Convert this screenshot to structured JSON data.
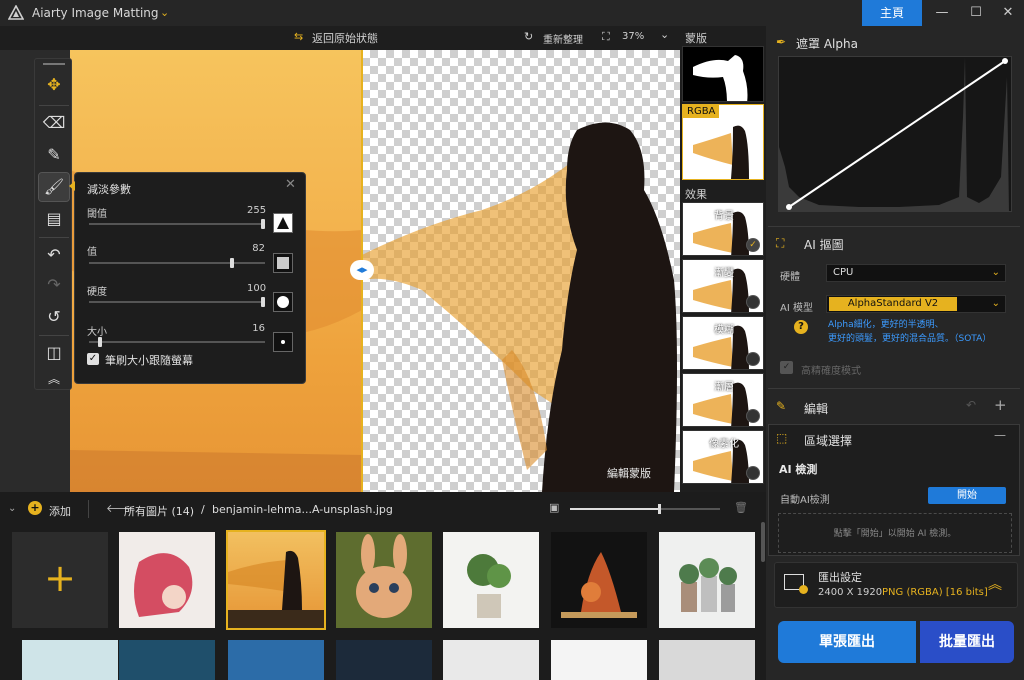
{
  "app": {
    "title": "Aiarty Image Matting",
    "home_label": "主頁"
  },
  "canvas_top": {
    "restore_label": "返回原始狀態",
    "refresh_label": "重新整理",
    "zoom": "37%"
  },
  "canvas": {
    "mask_edit_label": "編輯蒙版"
  },
  "popup": {
    "title": "減淡參數",
    "sliders": [
      {
        "label": "閾值",
        "value": "255",
        "level": 1.0
      },
      {
        "label": "值",
        "value": "82",
        "level": 0.82
      },
      {
        "label": "硬度",
        "value": "100",
        "level": 1.0
      },
      {
        "label": "大小",
        "value": "16",
        "level": 0.05
      }
    ],
    "checkbox_label": "筆刷大小跟隨螢幕"
  },
  "strip": {
    "mask_label": "蒙版",
    "rgba_label": "RGBA",
    "effects_label": "效果",
    "effects": [
      "背景",
      "漸變",
      "模糊",
      "漸層",
      "像素化"
    ]
  },
  "right": {
    "alpha_title": "遮罩 Alpha",
    "ai_title": "AI 摳圖",
    "hardware_label": "硬體",
    "hardware_value": "CPU",
    "model_label": "AI 模型",
    "model_value": "AlphaStandard  V2",
    "model_desc_1": "Alpha細化，更好的半透明、",
    "model_desc_2": "更好的頭髮，更好的混合品質。（SOTA）",
    "hq_label": "高精確度模式",
    "edit_title": "編輯",
    "region_title": "區域選擇",
    "ai_detect_title": "AI 檢測",
    "auto_detect_label": "自動AI檢測",
    "start_label": "開始",
    "hint": "點擊「開始」以開始 AI 檢測。",
    "export_title": "匯出設定",
    "export_size": "2400 X 1920",
    "export_format": "PNG (RGBA) [16 bits]",
    "single_export": "單張匯出",
    "batch_export": "批量匯出"
  },
  "gallery": {
    "add_label": "添加",
    "all_images": "所有圖片 (14)",
    "separator": "/",
    "current_file": "benjamin-lehma...A-unsplash.jpg"
  },
  "colors": {
    "accent": "#e6b21f",
    "primary": "#1f7ad9",
    "link": "#3c9bff"
  }
}
